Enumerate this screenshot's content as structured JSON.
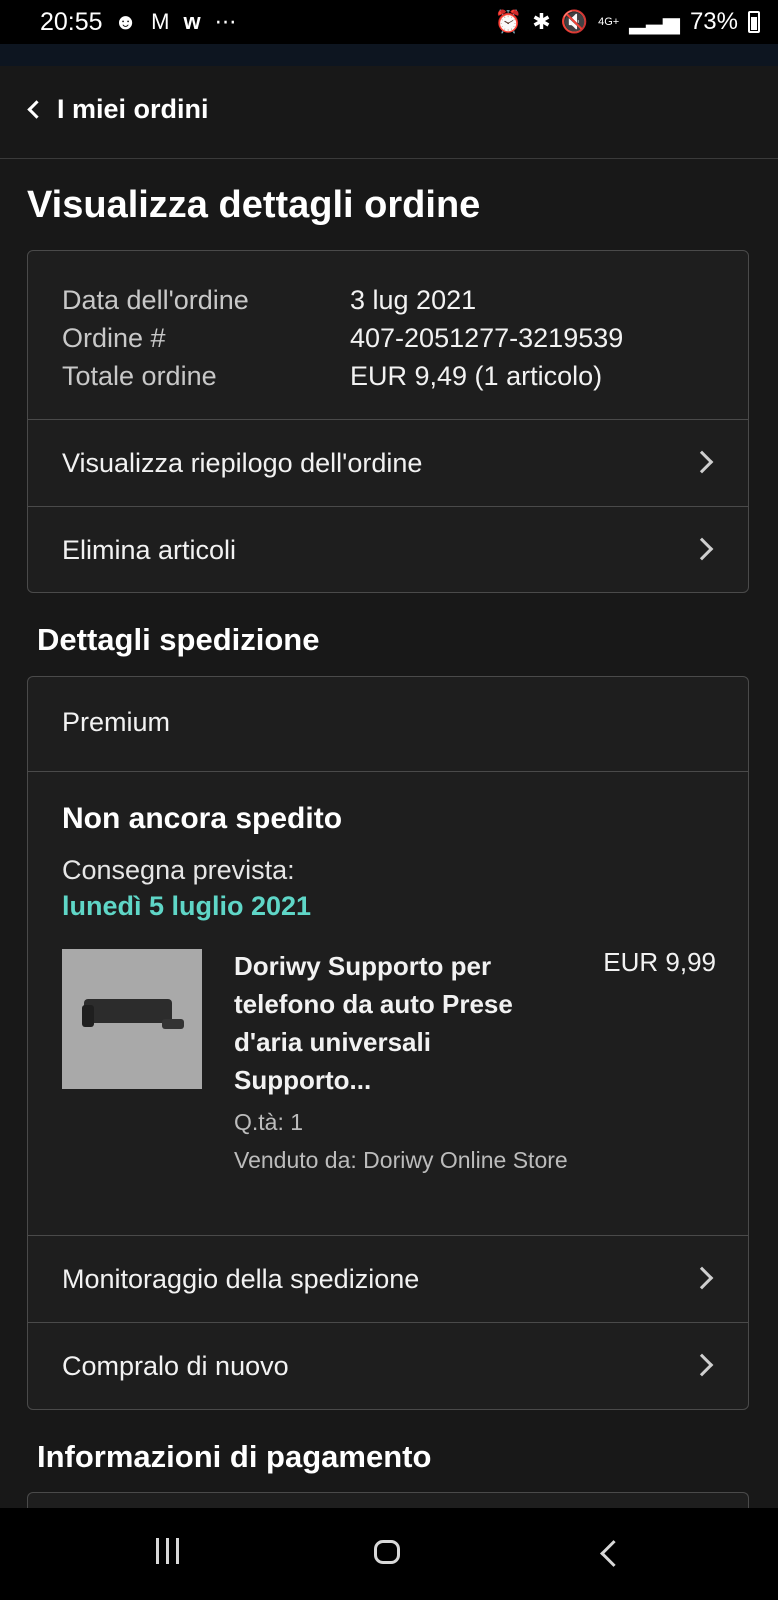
{
  "status_bar": {
    "time": "20:55",
    "left_icons": [
      "person-icon",
      "gmail-icon",
      "w-app-icon",
      "more-dots-icon"
    ],
    "right_icons": [
      "alarm-icon",
      "bluetooth-icon",
      "mute-icon",
      "4g-icon",
      "signal-icon"
    ],
    "network": "4G+",
    "battery": "73%"
  },
  "header": {
    "back_label": "I miei ordini"
  },
  "page_title": "Visualizza dettagli ordine",
  "order_summary": {
    "rows": [
      {
        "label": "Data dell'ordine",
        "value": "3 lug 2021"
      },
      {
        "label": "Ordine #",
        "value": "407-2051277-3219539"
      },
      {
        "label": "Totale ordine",
        "value": "EUR 9,49 (1 articolo)"
      }
    ],
    "links": [
      {
        "label": "Visualizza riepilogo dell'ordine"
      },
      {
        "label": "Elimina articoli"
      }
    ]
  },
  "shipping": {
    "section_title": "Dettagli spedizione",
    "method": "Premium",
    "status": "Non ancora spedito",
    "delivery_label": "Consegna prevista:",
    "delivery_date": "lunedì 5 luglio 2021",
    "item": {
      "title": "Doriwy Supporto per telefono da auto Prese d'aria universali Supporto...",
      "price": "EUR 9,99",
      "quantity": "Q.tà: 1",
      "seller": "Venduto da: Doriwy Online Store"
    },
    "links": [
      {
        "label": "Monitoraggio della spedizione"
      },
      {
        "label": "Compralo di nuovo"
      }
    ]
  },
  "payment": {
    "section_title": "Informazioni di pagamento"
  },
  "colors": {
    "background": "#181818",
    "card": "#1e1e1e",
    "border": "#4a4a4a",
    "accent_date": "#5fd6c7"
  }
}
